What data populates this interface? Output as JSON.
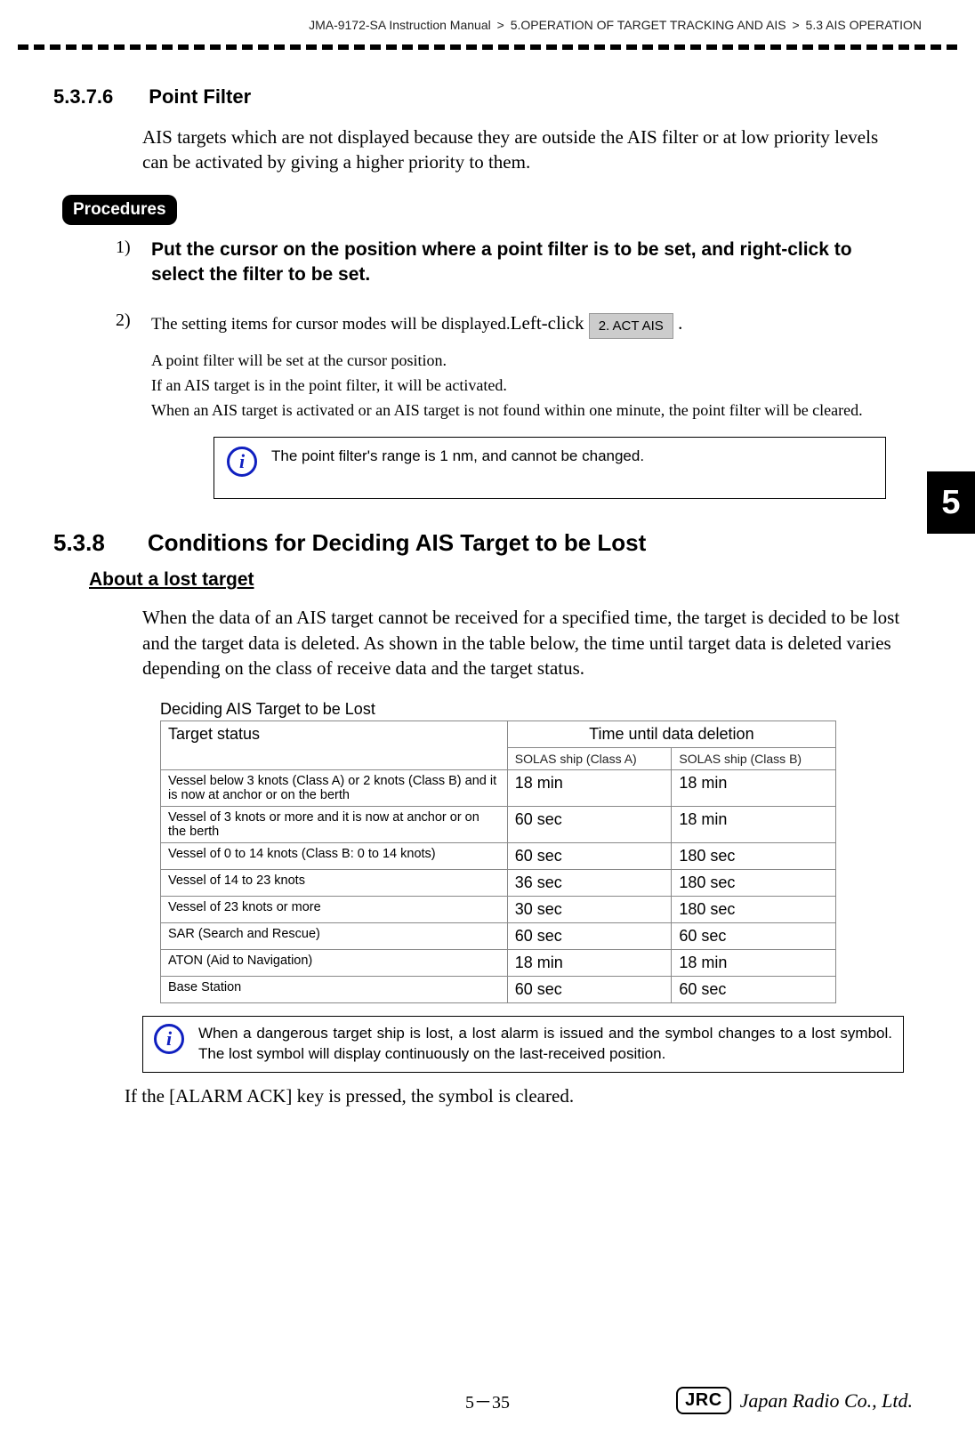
{
  "header": {
    "manual": "JMA-9172-SA Instruction Manual",
    "ch": "5.OPERATION OF TARGET TRACKING AND AIS",
    "sec": "5.3  AIS OPERATION"
  },
  "s1": {
    "num": "5.3.7.6",
    "title": "Point Filter",
    "intro": "AIS targets which are not displayed because they are outside the AIS filter or at low priority levels can be activated by giving a higher priority to them."
  },
  "procedures_label": "Procedures",
  "step1": {
    "num": "1)",
    "text": "Put the cursor on the position where a point filter is to be set, and right-click to select the filter to be set."
  },
  "step2": {
    "num": "2)",
    "pre": "The setting items for cursor modes will be displayed.",
    "action": "Left-click ",
    "button": "2. ACT AIS",
    "post": " .",
    "p1": "A point filter will be set at the cursor position.",
    "p2": "If an AIS target is in the point filter, it will be activated.",
    "p3": "When an AIS target is activated or an AIS target is not found within one minute, the point filter will be cleared."
  },
  "info1": "The point filter's range is 1 nm, and cannot be changed.",
  "s2": {
    "num": "5.3.8",
    "title": "Conditions for Deciding AIS Target to be Lost",
    "sub": "About a lost target",
    "para": "When the data of an AIS target cannot be received for a specified time, the target is decided to be lost and the target data is deleted. As shown in the table below, the time until target data is deleted varies depending on the class of receive data and the target status."
  },
  "table": {
    "caption": "Deciding AIS Target to be Lost",
    "h_status": "Target status",
    "h_time": "Time until data deletion",
    "h_classA": "SOLAS ship (Class A)",
    "h_classB": "SOLAS ship (Class B)",
    "rows": [
      {
        "s": "Vessel below 3 knots (Class A) or 2 knots (Class B) and it is now at anchor or on the berth",
        "a": "18 min",
        "b": "18 min"
      },
      {
        "s": "Vessel of 3 knots or more and it is now at anchor or on the berth",
        "a": "60 sec",
        "b": "18 min"
      },
      {
        "s": "Vessel of 0 to 14 knots (Class B: 0 to 14 knots)",
        "a": "60 sec",
        "b": "180 sec"
      },
      {
        "s": "Vessel of 14 to 23 knots",
        "a": "36 sec",
        "b": "180 sec"
      },
      {
        "s": "Vessel of 23 knots or more",
        "a": "30 sec",
        "b": "180 sec"
      },
      {
        "s": "SAR (Search and Rescue)",
        "a": "60 sec",
        "b": "60 sec"
      },
      {
        "s": "ATON (Aid to Navigation)",
        "a": "18 min",
        "b": "18 min"
      },
      {
        "s": "Base Station",
        "a": "60 sec",
        "b": "60 sec"
      }
    ]
  },
  "info2": "When a dangerous target ship is lost, a lost alarm is issued and the symbol changes to a lost symbol. The lost symbol will display continuously on the last-received position.",
  "closing": "If the [ALARM ACK] key is pressed, the symbol is cleared.",
  "chapter_tab": "5",
  "footer": {
    "page": "5－35",
    "brand_box": "JRC",
    "brand_text": "Japan Radio Co., Ltd."
  }
}
